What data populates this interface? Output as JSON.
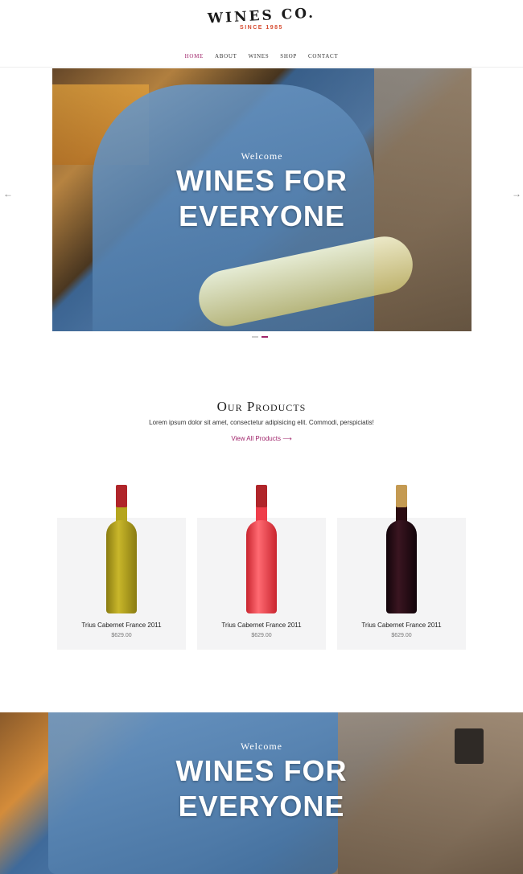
{
  "header": {
    "logo": "WINES CO.",
    "logo_sub": "SINCE 1985",
    "nav": [
      {
        "label": "HOME",
        "active": true
      },
      {
        "label": "ABOUT",
        "active": false
      },
      {
        "label": "WINES",
        "active": false
      },
      {
        "label": "SHOP",
        "active": false
      },
      {
        "label": "CONTACT",
        "active": false
      }
    ]
  },
  "hero": {
    "kicker": "Welcome",
    "title_line1": "WINES FOR",
    "title_line2": "EVERYONE",
    "prev_icon": "←",
    "next_icon": "→",
    "slides": 2,
    "active_slide": 2
  },
  "products_section": {
    "title": "Our Products",
    "description": "Lorem ipsum dolor sit amet, consectetur adipisicing elit. Commodi, perspiciatis!",
    "view_all": "View All Products ⟶",
    "items": [
      {
        "name": "Trius Cabernet France 2011",
        "price": "$629.00",
        "wine_color": "#b5a51e",
        "cap_color": "#b0252a"
      },
      {
        "name": "Trius Cabernet France 2011",
        "price": "$629.00",
        "wine_color": "#ef3d4a",
        "cap_color": "#b0252a"
      },
      {
        "name": "Trius Cabernet France 2011",
        "price": "$629.00",
        "wine_color": "#2a0a10",
        "cap_color": "#c49a52"
      }
    ]
  },
  "hero2": {
    "kicker": "Welcome",
    "title_line1": "WINES FOR",
    "title_line2": "EVERYONE"
  },
  "colors": {
    "accent": "#a0256b",
    "logo_sub": "#d64a2f",
    "card_bg": "#f4f4f5"
  }
}
